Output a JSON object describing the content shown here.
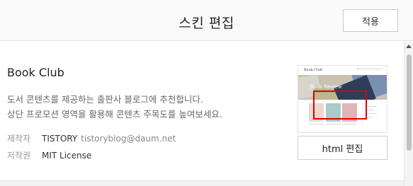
{
  "header": {
    "title": "스킨 편집",
    "apply_label": "적용"
  },
  "skin": {
    "name": "Book Club",
    "description_lines": [
      "도서 콘텐츠를 제공하는 출판사 블로그에 추천합니다.",
      "상단 프로모션 영역을 활용해 콘텐츠 주목도를 높여보세요."
    ],
    "author_label": "제작자",
    "author": "TISTORY",
    "author_email": "tistoryblog@daum.net",
    "license_label": "저작권",
    "license": "MIT License"
  },
  "preview": {
    "logo_text": "Book Club",
    "hero_title": "Book Review"
  },
  "actions": {
    "html_edit_label": "html 편집"
  },
  "highlight": {
    "color": "#e00000",
    "target": "html-edit-button"
  }
}
